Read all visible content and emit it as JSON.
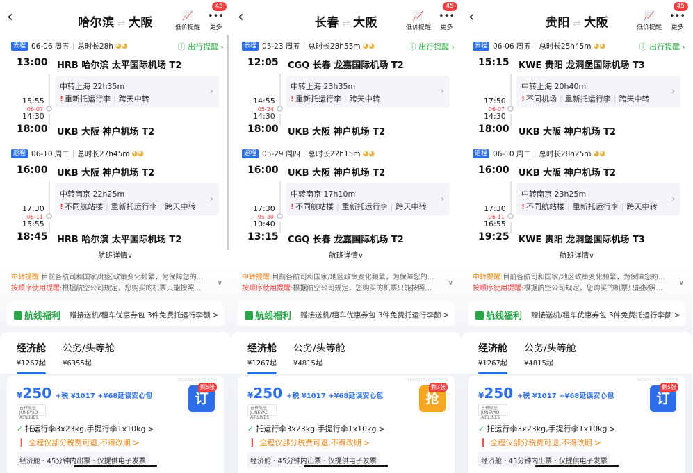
{
  "header": {
    "price_alert": "低价提醒",
    "more": "更多",
    "badge": "45",
    "arrow": "⇌"
  },
  "labels": {
    "outbound": "去程",
    "return": "返程",
    "travel_remind": "出行提醒",
    "detail": "航班详情∨",
    "note1_title": "中转提醒:",
    "note1_body": "目前各航司和国家/地区政策变化频繁，为保障您的…",
    "note2_title": "按顺序使用提醒:",
    "note2_body": "根据航空公司规定，您购买的机票只能按照…",
    "benefit_logo": "航线福利",
    "benefit_text": "赠接送机/租车优惠券包  3件免费托运行李额 >",
    "cabin_econ": "经济舱",
    "cabin_biz": "公务/头等舱",
    "tax": "+税 ¥1017 +¥68延误安心包",
    "airline_name": "吉祥航空",
    "airline_sub": "JUNEYAO AIRLINES",
    "baggage": "托运行李3x23kg,手提行李1x10kg >",
    "refund": "❗ 全程仅部分税费可退,不得改期 >",
    "info_pill": "经济舱 · 45分钟内出票 · 仅提供电子发票"
  },
  "panels": [
    {
      "from_city": "哈尔滨",
      "to_city": "大阪",
      "outbound": {
        "date": "06-06 周五",
        "duration": "总时长28h",
        "dep_time": "13:00",
        "dep_airport": "HRB 哈尔滨 太平国际机场 T2",
        "arr_mid": "15:55",
        "mid_date": "06-07",
        "dep_mid": "14:30",
        "transfer": "中转上海 22h35m",
        "tags": [
          "重新托运行李",
          "跨天中转"
        ],
        "arr_time": "18:00",
        "arr_airport": "UKB 大阪 神户机场 T2"
      },
      "return": {
        "date": "06-10 周二",
        "duration": "总时长27h45m",
        "dep_time": "16:00",
        "dep_airport": "UKB 大阪 神户机场 T2",
        "arr_mid": "17:30",
        "mid_date": "06-11",
        "dep_mid": "15:55",
        "transfer": "中转南京 22h25m",
        "tags": [
          "不同航站楼",
          "重新托运行李",
          "跨天中转"
        ],
        "arr_time": "18:45",
        "arr_airport": "HRB 哈尔滨 太平国际机场 T2"
      },
      "econ_price": "¥1267起",
      "biz_price": "¥6355起",
      "price": "250",
      "code": "DLKNPC4074ZH",
      "left": "剩5张",
      "book": "订",
      "book_color": "#2c6fe8"
    },
    {
      "from_city": "长春",
      "to_city": "大阪",
      "outbound": {
        "date": "05-23 周五",
        "duration": "总时长28h55m",
        "dep_time": "12:05",
        "dep_airport": "CGQ 长春 龙嘉国际机场 T2",
        "arr_mid": "14:55",
        "mid_date": "05-24",
        "dep_mid": "14:30",
        "transfer": "中转上海 23h35m",
        "tags": [
          "重新托运行李",
          "跨天中转"
        ],
        "arr_time": "18:00",
        "arr_airport": "UKB 大阪 神户机场 T2"
      },
      "return": {
        "date": "05-29 周四",
        "duration": "总时长22h15m",
        "dep_time": "16:00",
        "dep_airport": "UKB 大阪 神户机场 T2",
        "arr_mid": "17:30",
        "mid_date": "05-30",
        "dep_mid": "10:40",
        "transfer": "中转南京 17h10m",
        "tags": [
          "不同航站楼",
          "重新托运行李",
          "跨天中转"
        ],
        "arr_time": "13:15",
        "arr_airport": "CGQ 长春 龙嘉国际机场 T2"
      },
      "econ_price": "¥1267起",
      "biz_price": "¥4815起",
      "price": "250",
      "code": "NMO5IPLQK07B9",
      "left": "剩3张",
      "book": "抢",
      "book_color": "#f5a623"
    },
    {
      "from_city": "贵阳",
      "to_city": "大阪",
      "outbound": {
        "date": "06-06 周五",
        "duration": "总时长25h45m",
        "dep_time": "15:15",
        "dep_airport": "KWE 贵阳 龙洞堡国际机场 T3",
        "arr_mid": "17:50",
        "mid_date": "06-07",
        "dep_mid": "14:30",
        "transfer": "中转上海 20h40m",
        "tags": [
          "不同机场",
          "重新托运行李",
          "跨天中转"
        ],
        "arr_time": "18:00",
        "arr_airport": "UKB 大阪 神户机场 T2"
      },
      "return": {
        "date": "06-10 周二",
        "duration": "总时长28h25m",
        "dep_time": "16:00",
        "dep_airport": "UKB 大阪 神户机场 T2",
        "arr_mid": "17:30",
        "mid_date": "06-11",
        "dep_mid": "16:55",
        "transfer": "中转南京 23h25m",
        "tags": [
          "不同航站楼",
          "重新托运行李",
          "跨天中转"
        ],
        "arr_time": "19:25",
        "arr_airport": "KWE 贵阳 龙洞堡国际机场 T3"
      },
      "econ_price": "¥1267起",
      "biz_price": "¥4815起",
      "price": "250",
      "code": "GOVHYQKLIBF5N",
      "left": "剩5张",
      "book": "订",
      "book_color": "#2c6fe8"
    }
  ]
}
